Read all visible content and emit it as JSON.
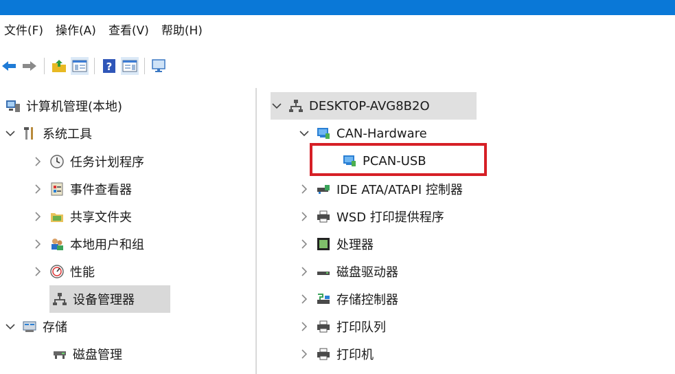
{
  "menu": [
    {
      "label": "文件(F)"
    },
    {
      "label": "操作(A)"
    },
    {
      "label": "查看(V)"
    },
    {
      "label": "帮助(H)"
    }
  ],
  "toolbar": {
    "icons": [
      "back-arrow-icon",
      "forward-arrow-icon",
      "folder-up-icon",
      "show-hide-console-tree-icon",
      "help-icon",
      "show-hide-action-pane-icon",
      "monitor-icon"
    ]
  },
  "left_tree": {
    "root": "计算机管理(本地)",
    "system_tools": "系统工具",
    "task_scheduler": "任务计划程序",
    "event_viewer": "事件查看器",
    "shared_folders": "共享文件夹",
    "local_users": "本地用户和组",
    "performance": "性能",
    "device_manager": "设备管理器",
    "storage": "存储",
    "disk_management": "磁盘管理"
  },
  "right_tree": {
    "host": "DESKTOP-AVG8B2O",
    "can_hardware": "CAN-Hardware",
    "pcan_usb": "PCAN-USB",
    "ide": "IDE ATA/ATAPI 控制器",
    "wsd": "WSD 打印提供程序",
    "processor": "处理器",
    "disk_drives": "磁盘驱动器",
    "storage_ctrl": "存储控制器",
    "print_queue": "打印队列",
    "printer": "打印机"
  },
  "colors": {
    "titlebar": "#0a78d7",
    "selection": "#d9d9d9",
    "highlight": "#d61f26"
  }
}
